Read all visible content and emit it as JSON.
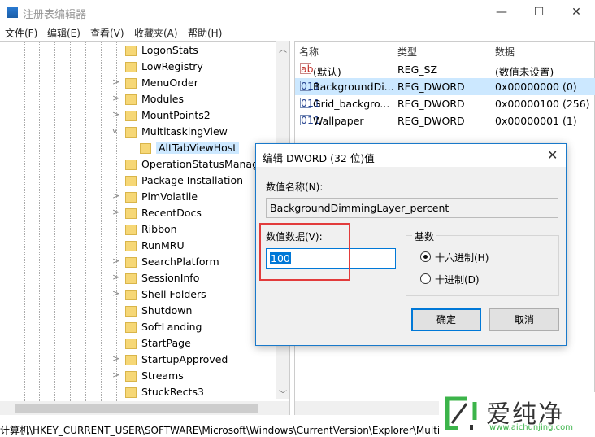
{
  "window": {
    "title": "注册表编辑器",
    "minimize": "—",
    "maximize": "☐",
    "close": "✕"
  },
  "menu": [
    "文件(F)",
    "编辑(E)",
    "查看(V)",
    "收藏夹(A)",
    "帮助(H)"
  ],
  "tree": {
    "items": [
      {
        "label": "LogonStats",
        "exp": ""
      },
      {
        "label": "LowRegistry",
        "exp": ""
      },
      {
        "label": "MenuOrder",
        "exp": ">"
      },
      {
        "label": "Modules",
        "exp": ">"
      },
      {
        "label": "MountPoints2",
        "exp": ">"
      },
      {
        "label": "MultitaskingView",
        "exp": "v"
      },
      {
        "label": "AltTabViewHost",
        "exp": "",
        "sub": true
      },
      {
        "label": "OperationStatusManager",
        "exp": ""
      },
      {
        "label": "Package Installation",
        "exp": ""
      },
      {
        "label": "PlmVolatile",
        "exp": ">"
      },
      {
        "label": "RecentDocs",
        "exp": ">"
      },
      {
        "label": "Ribbon",
        "exp": ""
      },
      {
        "label": "RunMRU",
        "exp": ""
      },
      {
        "label": "SearchPlatform",
        "exp": ">"
      },
      {
        "label": "SessionInfo",
        "exp": ">"
      },
      {
        "label": "Shell Folders",
        "exp": ">"
      },
      {
        "label": "Shutdown",
        "exp": ""
      },
      {
        "label": "SoftLanding",
        "exp": ""
      },
      {
        "label": "StartPage",
        "exp": ""
      },
      {
        "label": "StartupApproved",
        "exp": ">"
      },
      {
        "label": "Streams",
        "exp": ">"
      },
      {
        "label": "StuckRects3",
        "exp": ""
      }
    ]
  },
  "values": {
    "headers": [
      "名称",
      "类型",
      "数据"
    ],
    "rows": [
      {
        "icon": "ab",
        "name": "(默认)",
        "type": "REG_SZ",
        "data": "(数值未设置)"
      },
      {
        "icon": "011",
        "name": "BackgroundDi...",
        "type": "REG_DWORD",
        "data": "0x00000000 (0)",
        "selected": true
      },
      {
        "icon": "011",
        "name": "Grid_backgro...",
        "type": "REG_DWORD",
        "data": "0x00000100 (256)"
      },
      {
        "icon": "011",
        "name": "Wallpaper",
        "type": "REG_DWORD",
        "data": "0x00000001 (1)"
      }
    ]
  },
  "status": "计算机\\HKEY_CURRENT_USER\\SOFTWARE\\Microsoft\\Windows\\CurrentVersion\\Explorer\\MultitaskingView\\AltTabViewHost",
  "dialog": {
    "title": "编辑 DWORD (32 位)值",
    "close": "✕",
    "name_label": "数值名称(N):",
    "name_value": "BackgroundDimmingLayer_percent",
    "data_label": "数值数据(V):",
    "data_value": "100",
    "base_label": "基数",
    "hex_label": "十六进制(H)",
    "dec_label": "十进制(D)",
    "selected_base": "hex",
    "ok": "确定",
    "cancel": "取消"
  },
  "watermark": {
    "brand": "爱纯净",
    "url": "www.aichunjing.com"
  },
  "colors": {
    "selection": "#cce8ff",
    "accent": "#0078d7",
    "highlight_box": "#e23b3b",
    "watermark_green": "#3cb44a"
  }
}
